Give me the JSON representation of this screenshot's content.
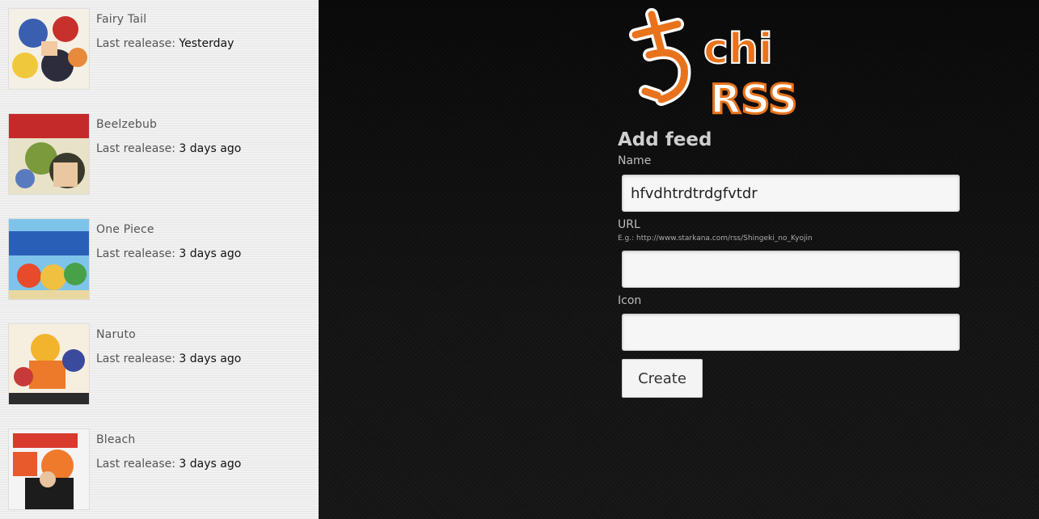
{
  "feeds": [
    {
      "name": "Fairy Tail",
      "release_label": "Last realease:",
      "release_value": "Yesterday",
      "cover_icon": "fairy-tail-cover-image"
    },
    {
      "name": "Beelzebub",
      "release_label": "Last realease:",
      "release_value": "3 days ago",
      "cover_icon": "beelzebub-cover-image"
    },
    {
      "name": "One Piece",
      "release_label": "Last realease:",
      "release_value": "3 days ago",
      "cover_icon": "one-piece-cover-image"
    },
    {
      "name": "Naruto",
      "release_label": "Last realease:",
      "release_value": "3 days ago",
      "cover_icon": "naruto-cover-image"
    },
    {
      "name": "Bleach",
      "release_label": "Last realease:",
      "release_value": "3 days ago",
      "cover_icon": "bleach-cover-image"
    }
  ],
  "logo": {
    "text_main": "chi",
    "text_rss": "RSS",
    "color": "#e8731c"
  },
  "form": {
    "title": "Add feed",
    "name_label": "Name",
    "name_value": "hfvdhtrdtrdgfvtdr",
    "url_label": "URL",
    "url_hint": "E.g.: http://www.starkana.com/rss/Shingeki_no_Kyojin",
    "url_value": "",
    "icon_label": "Icon",
    "icon_value": "",
    "submit_label": "Create"
  },
  "colors": {
    "accent": "#e8731c",
    "sidebar_bg": "#f1f1f1",
    "main_bg": "#141414"
  }
}
